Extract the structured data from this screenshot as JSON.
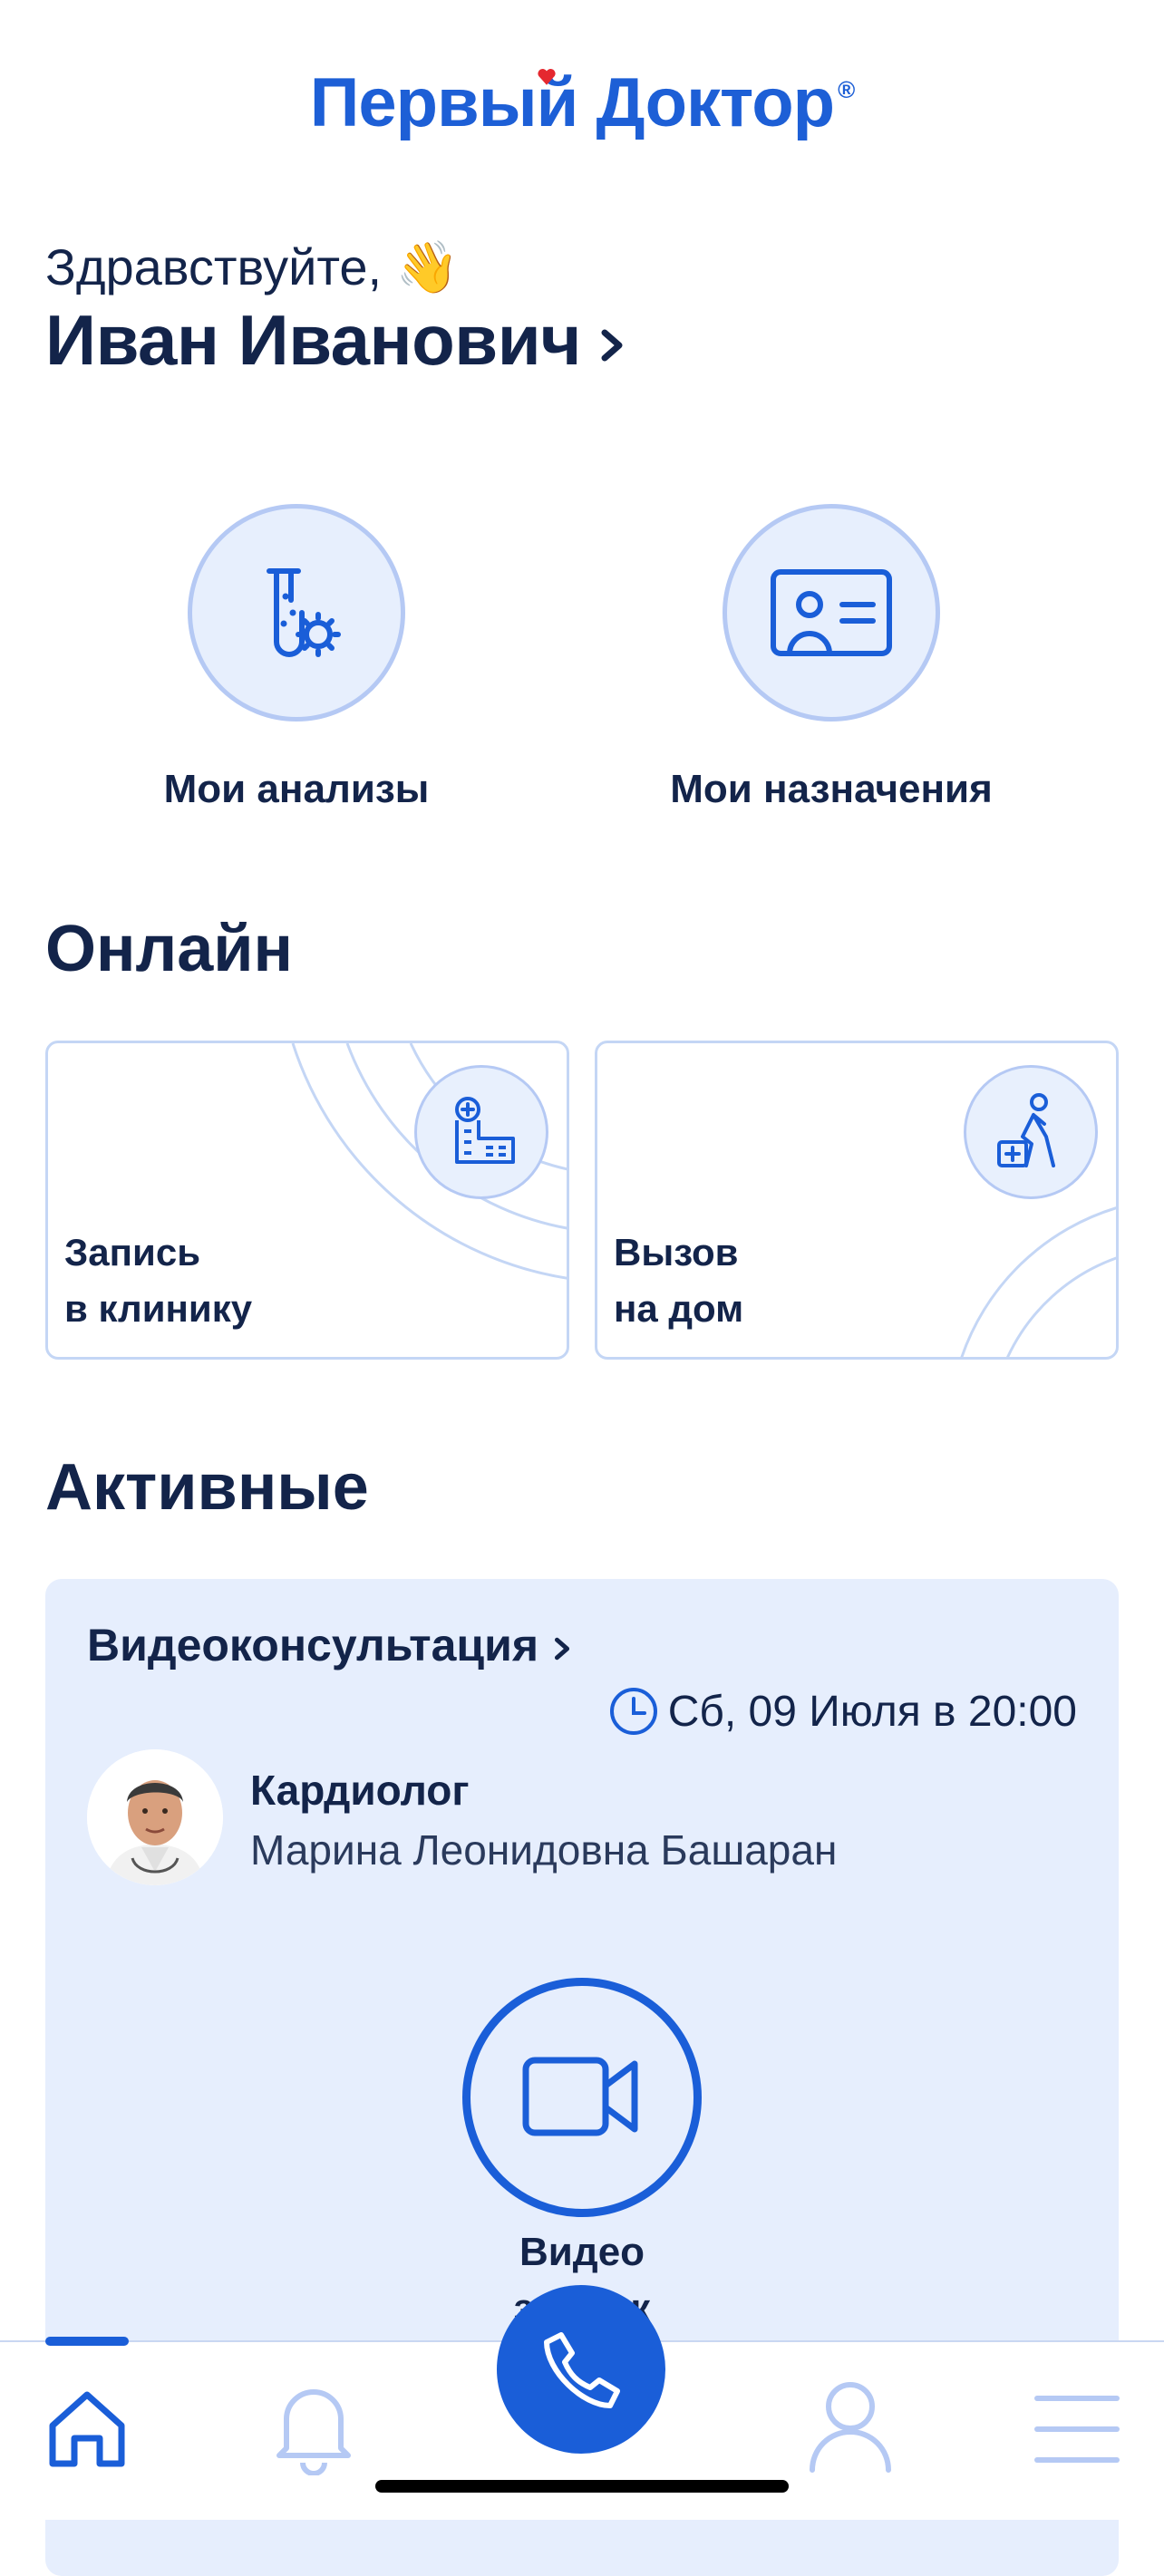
{
  "header": {
    "logo_text": "Первый Доктор",
    "logo_mark": "®"
  },
  "greeting": {
    "hello": "Здравствуйте,",
    "wave_emoji": "👋",
    "name": "Иван Иванович"
  },
  "quick_actions": [
    {
      "label": "Мои анализы",
      "icon": "test-tube-virus-icon"
    },
    {
      "label": "Мои назначения",
      "icon": "id-card-icon"
    }
  ],
  "online": {
    "title": "Онлайн",
    "cards": [
      {
        "line1": "Запись",
        "line2": "в клинику",
        "icon": "clinic-building-icon"
      },
      {
        "line1": "Вызов",
        "line2": "на дом",
        "icon": "doctor-walking-icon"
      }
    ]
  },
  "active": {
    "title": "Активные",
    "consultation": {
      "type": "Видеоконсультация",
      "datetime": "Сб, 09 Июля в 20:00",
      "specialty": "Кардиолог",
      "doctor": "Марина Леонидовна Башаран",
      "action_label": "Видео",
      "action_label_partial": "звонок"
    }
  },
  "bottom_nav": [
    {
      "name": "home",
      "icon": "home-icon",
      "active": true
    },
    {
      "name": "notifications",
      "icon": "bell-icon"
    },
    {
      "name": "call",
      "icon": "phone-icon"
    },
    {
      "name": "profile",
      "icon": "user-icon"
    },
    {
      "name": "menu",
      "icon": "menu-icon"
    }
  ],
  "colors": {
    "brand": "#1a5ed8",
    "text": "#13244a",
    "accent_heart": "#e5282f",
    "card_bg": "#e6eefd"
  }
}
